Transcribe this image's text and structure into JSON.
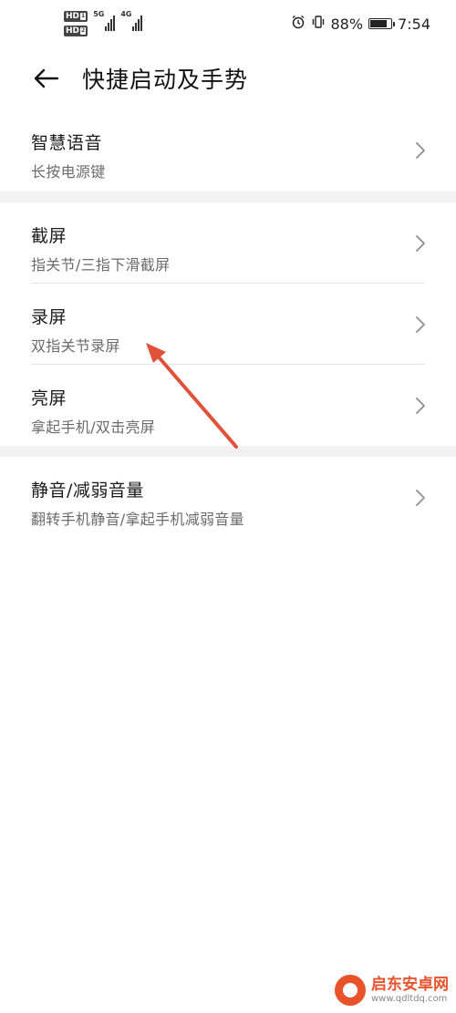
{
  "status_bar": {
    "sim1_badge": "HD",
    "sim1_sub": "1",
    "sim2_badge": "HD",
    "sim2_sub": "2",
    "net1_label": "5G",
    "net2_label": "4G",
    "alarm_icon": "alarm-icon",
    "vibrate_icon": "vibrate-icon",
    "battery_percent": "88%",
    "battery_level": 0.88,
    "time": "7:54"
  },
  "header": {
    "back_icon": "back-arrow-icon",
    "title": "快捷启动及手势"
  },
  "groups": [
    {
      "items": [
        {
          "title": "智慧语音",
          "subtitle": "长按电源键"
        }
      ]
    },
    {
      "items": [
        {
          "title": "截屏",
          "subtitle": "指关节/三指下滑截屏"
        },
        {
          "title": "录屏",
          "subtitle": "双指关节录屏"
        },
        {
          "title": "亮屏",
          "subtitle": "拿起手机/双击亮屏"
        }
      ]
    },
    {
      "items": [
        {
          "title": "静音/减弱音量",
          "subtitle": "翻转手机静音/拿起手机减弱音量"
        }
      ]
    }
  ],
  "colors": {
    "annotation_arrow": "#e0533a",
    "divider_band": "#f2f2f2",
    "watermark_brand": "#e8532b"
  },
  "watermark": {
    "name": "启东安卓网",
    "url": "www.qdltdq.com"
  }
}
